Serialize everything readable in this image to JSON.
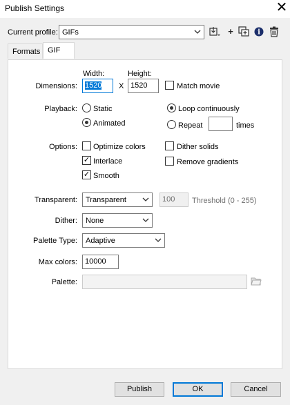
{
  "window": {
    "title": "Publish Settings",
    "close_glyph": "✕"
  },
  "profile": {
    "label": "Current profile:",
    "value": "GIFs",
    "toolbar_icons": [
      "import-export-icon",
      "add-profile-icon",
      "duplicate-profile-icon",
      "profile-info-icon",
      "trash-icon"
    ],
    "toolbar_glyphs": {
      "add": "+",
      "info": "i"
    }
  },
  "tabs": [
    {
      "label": "Formats",
      "active": false
    },
    {
      "label": "GIF",
      "active": true
    }
  ],
  "dimensions": {
    "label": "Dimensions:",
    "width_label": "Width:",
    "height_label": "Height:",
    "width_value": "1520",
    "height_value": "1520",
    "separator": "X",
    "match_movie_label": "Match movie",
    "match_movie_checked": false
  },
  "playback": {
    "label": "Playback:",
    "static_label": "Static",
    "animated_label": "Animated",
    "selected_mode": "animated",
    "loop_label": "Loop continuously",
    "repeat_label": "Repeat",
    "repeat_value": "",
    "times_label": "times",
    "selected_loop": "loop"
  },
  "options": {
    "label": "Options:",
    "optimize_colors": {
      "label": "Optimize colors",
      "checked": false,
      "glyph": ""
    },
    "interlace": {
      "label": "Interlace",
      "checked": true,
      "glyph": "✓"
    },
    "smooth": {
      "label": "Smooth",
      "checked": true,
      "glyph": "✓"
    },
    "dither_solids": {
      "label": "Dither solids",
      "checked": false,
      "glyph": ""
    },
    "remove_gradients": {
      "label": "Remove gradients",
      "checked": false,
      "glyph": ""
    }
  },
  "transparent": {
    "label": "Transparent:",
    "value": "Transparent",
    "threshold_value": "100",
    "threshold_label": "Threshold (0 - 255)"
  },
  "dither": {
    "label": "Dither:",
    "value": "None"
  },
  "palette_type": {
    "label": "Palette Type:",
    "value": "Adaptive"
  },
  "max_colors": {
    "label": "Max colors:",
    "value": "10000"
  },
  "palette": {
    "label": "Palette:",
    "value": "",
    "browse_icon": "folder-icon"
  },
  "buttons": {
    "publish": "Publish",
    "ok": "OK",
    "cancel": "Cancel"
  },
  "colors": {
    "accent": "#0078d7",
    "window_bg": "#f0f0f0",
    "panel_bg": "#ffffff"
  }
}
